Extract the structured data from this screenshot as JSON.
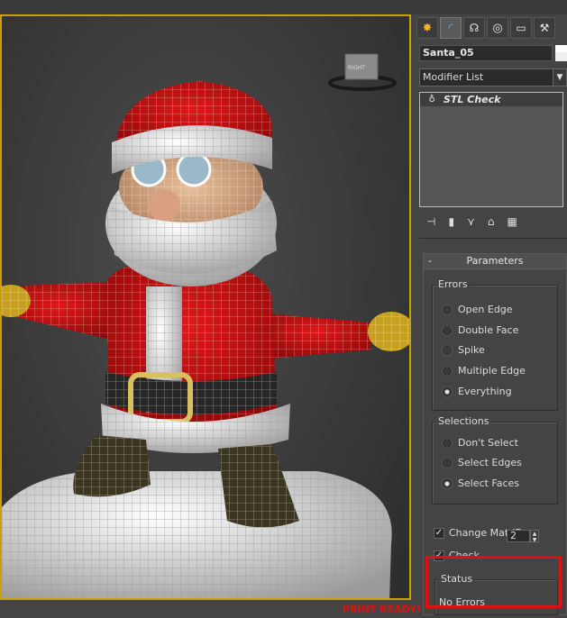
{
  "object_name": "Santa_05",
  "modifier_list": {
    "label": "Modifier List"
  },
  "stack": {
    "items": [
      {
        "label": "STL Check"
      }
    ]
  },
  "toolbar_tabs": [
    "create-icon",
    "modify-icon",
    "hierarchy-icon",
    "motion-icon",
    "display-icon",
    "utilities-icon"
  ],
  "stack_tools": [
    "pin-stack-icon",
    "show-end-result-icon",
    "make-unique-icon",
    "remove-modifier-icon",
    "configure-modifier-sets-icon"
  ],
  "parameters": {
    "title": "Parameters",
    "collapse_symbol": "-",
    "errors": {
      "title": "Errors",
      "options": [
        {
          "label": "Open Edge",
          "selected": false
        },
        {
          "label": "Double Face",
          "selected": false
        },
        {
          "label": "Spike",
          "selected": false
        },
        {
          "label": "Multiple Edge",
          "selected": false
        },
        {
          "label": "Everything",
          "selected": true
        }
      ]
    },
    "selections": {
      "title": "Selections",
      "options": [
        {
          "label": "Don't Select",
          "selected": false
        },
        {
          "label": "Select Edges",
          "selected": false
        },
        {
          "label": "Select Faces",
          "selected": true
        }
      ]
    },
    "change_mat_id": {
      "label": "Change Mat-ID",
      "checked": true,
      "value": "2"
    },
    "check": {
      "label": "Check",
      "checked": true
    },
    "status": {
      "title": "Status",
      "text": "No Errors"
    }
  },
  "viewport": {
    "viewcube_label": "RIGHT",
    "active_border_color": "#c8a200"
  },
  "print_ready": "PRINT READY!",
  "colors": {
    "highlight_red": "#e01010",
    "panel_bg": "#444444"
  }
}
